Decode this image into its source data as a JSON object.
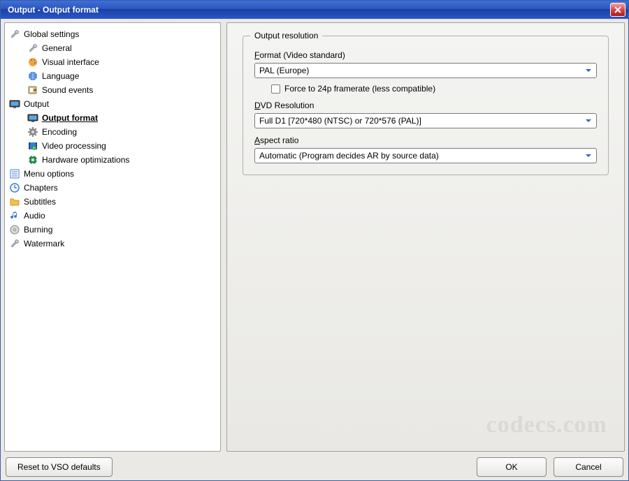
{
  "title": "Output - Output format",
  "sidebar": {
    "items": [
      {
        "label": "Global settings"
      },
      {
        "label": "General"
      },
      {
        "label": "Visual interface"
      },
      {
        "label": "Language"
      },
      {
        "label": "Sound events"
      },
      {
        "label": "Output"
      },
      {
        "label": "Output format"
      },
      {
        "label": "Encoding"
      },
      {
        "label": "Video processing"
      },
      {
        "label": "Hardware optimizations"
      },
      {
        "label": "Menu options"
      },
      {
        "label": "Chapters"
      },
      {
        "label": "Subtitles"
      },
      {
        "label": "Audio"
      },
      {
        "label": "Burning"
      },
      {
        "label": "Watermark"
      }
    ]
  },
  "panel": {
    "legend": "Output resolution",
    "format": {
      "prefix": "F",
      "rest": "ormat (Video standard)",
      "value": "PAL (Europe)"
    },
    "force24p": "Force to 24p framerate (less compatible)",
    "dvd": {
      "prefix": "D",
      "rest": "VD Resolution",
      "value": "Full D1 [720*480 (NTSC) or 720*576 (PAL)]"
    },
    "aspect": {
      "prefix": "A",
      "rest": "spect ratio",
      "value": "Automatic (Program decides AR by source data)"
    }
  },
  "buttons": {
    "reset": "Reset to VSO defaults",
    "ok": "OK",
    "cancel": "Cancel"
  },
  "watermark_text": "codecs.com"
}
